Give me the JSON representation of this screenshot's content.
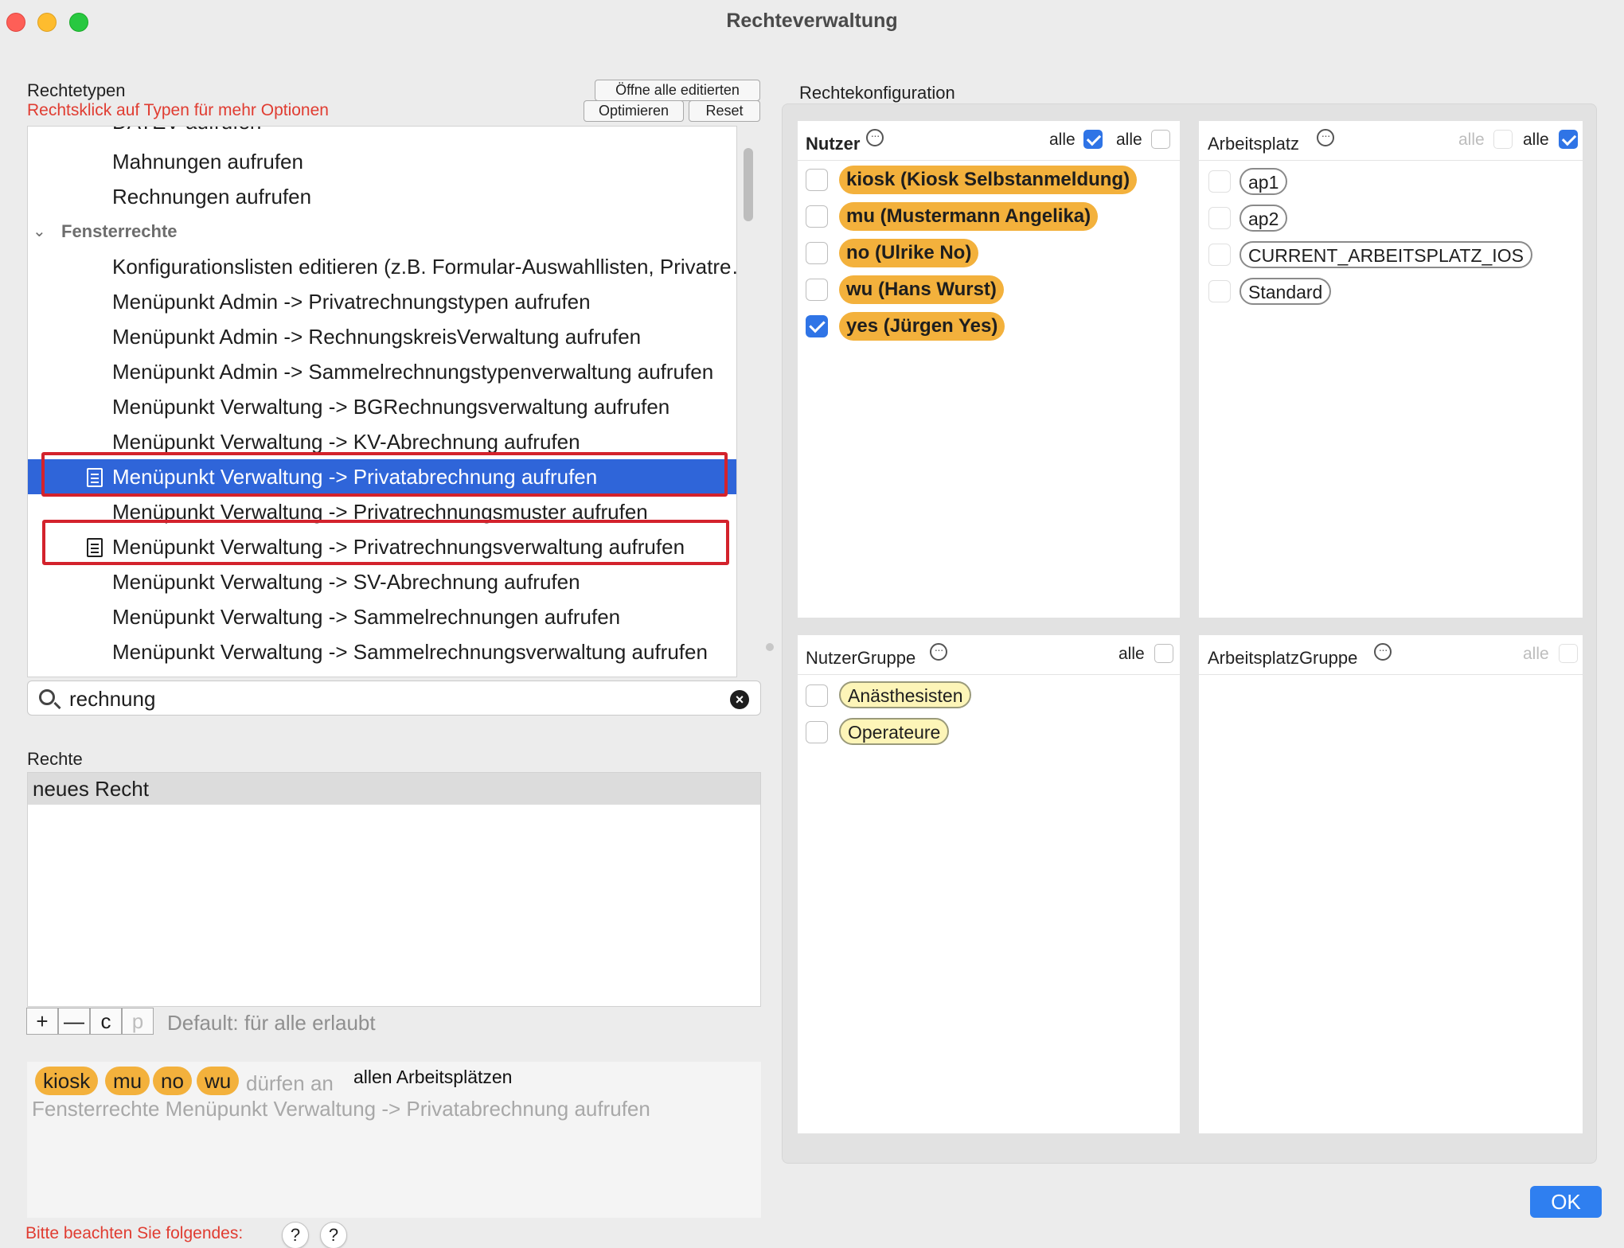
{
  "window": {
    "title": "Rechteverwaltung"
  },
  "left": {
    "types_title": "Rechtetypen",
    "types_hint": "Rechtsklick auf Typen für mehr Optionen",
    "btn_open_all": "Öffne alle editierten",
    "btn_optimize": "Optimieren",
    "btn_reset": "Reset",
    "tree": {
      "partial_top": "DATEV aufrufen",
      "items_a": [
        "Mahnungen aufrufen",
        "Rechnungen aufrufen"
      ],
      "group": "Fensterrechte",
      "items_b": [
        "Konfigurationslisten editieren (z.B. Formular-Auswahllisten, Privatrechnungsvorlagen)",
        "Menüpunkt Admin -> Privatrechnungstypen aufrufen",
        "Menüpunkt Admin -> RechnungskreisVerwaltung aufrufen",
        "Menüpunkt Admin -> Sammelrechnungstypenverwaltung aufrufen",
        "Menüpunkt Verwaltung -> BGRechnungsverwaltung aufrufen",
        "Menüpunkt Verwaltung -> KV-Abrechnung aufrufen",
        "Menüpunkt Verwaltung -> Privatabrechnung aufrufen",
        "Menüpunkt Verwaltung -> Privatrechnungsmuster aufrufen",
        "Menüpunkt Verwaltung -> Privatrechnungsverwaltung aufrufen",
        "Menüpunkt Verwaltung -> SV-Abrechnung aufrufen",
        "Menüpunkt Verwaltung -> Sammelrechnungen aufrufen",
        "Menüpunkt Verwaltung -> Sammelrechnungsverwaltung aufrufen"
      ]
    },
    "search": {
      "value": "rechnung"
    },
    "rights_title": "Rechte",
    "rights_items": [
      "neues Recht"
    ],
    "toolbar": {
      "add": "+",
      "remove": "—",
      "c": "c",
      "p": "p"
    },
    "default_text": "Default: für alle erlaubt",
    "summary": {
      "chips": [
        "kiosk",
        "mu",
        "no",
        "wu"
      ],
      "may_at": "dürfen an",
      "all_workplaces": "allen Arbeitsplätzen",
      "line2": "Fensterrechte Menüpunkt Verwaltung -> Privatabrechnung aufrufen"
    },
    "footer_note": "Bitte beachten Sie folgendes:",
    "help": [
      "?",
      "?"
    ]
  },
  "right": {
    "title": "Rechtekonfiguration",
    "nutzer": {
      "title": "Nutzer",
      "alle1": "alle",
      "alle2": "alle",
      "users": [
        {
          "label": "kiosk (Kiosk Selbstanmeldung)",
          "checked": false
        },
        {
          "label": "mu (Mustermann Angelika)",
          "checked": false
        },
        {
          "label": "no (Ulrike No)",
          "checked": false
        },
        {
          "label": "wu (Hans Wurst)",
          "checked": false
        },
        {
          "label": "yes (Jürgen Yes)",
          "checked": true
        }
      ]
    },
    "arbeitsplatz": {
      "title": "Arbeitsplatz",
      "alle1": "alle",
      "alle2": "alle",
      "items": [
        "ap1",
        "ap2",
        "CURRENT_ARBEITSPLATZ_IOS",
        "Standard"
      ]
    },
    "nutzergruppe": {
      "title": "NutzerGruppe",
      "alle": "alle",
      "items": [
        "Anästhesisten",
        "Operateure"
      ]
    },
    "arbeitsplatzgruppe": {
      "title": "ArbeitsplatzGruppe",
      "alle": "alle"
    },
    "ok": "OK"
  },
  "colors": {
    "selection": "#2f65d9",
    "user_chip": "#f3b13c",
    "group_chip": "#fdf5b8",
    "checkbox_checked": "#2f74e6",
    "highlight": "#d3222c",
    "hint_red": "#e03c31"
  }
}
